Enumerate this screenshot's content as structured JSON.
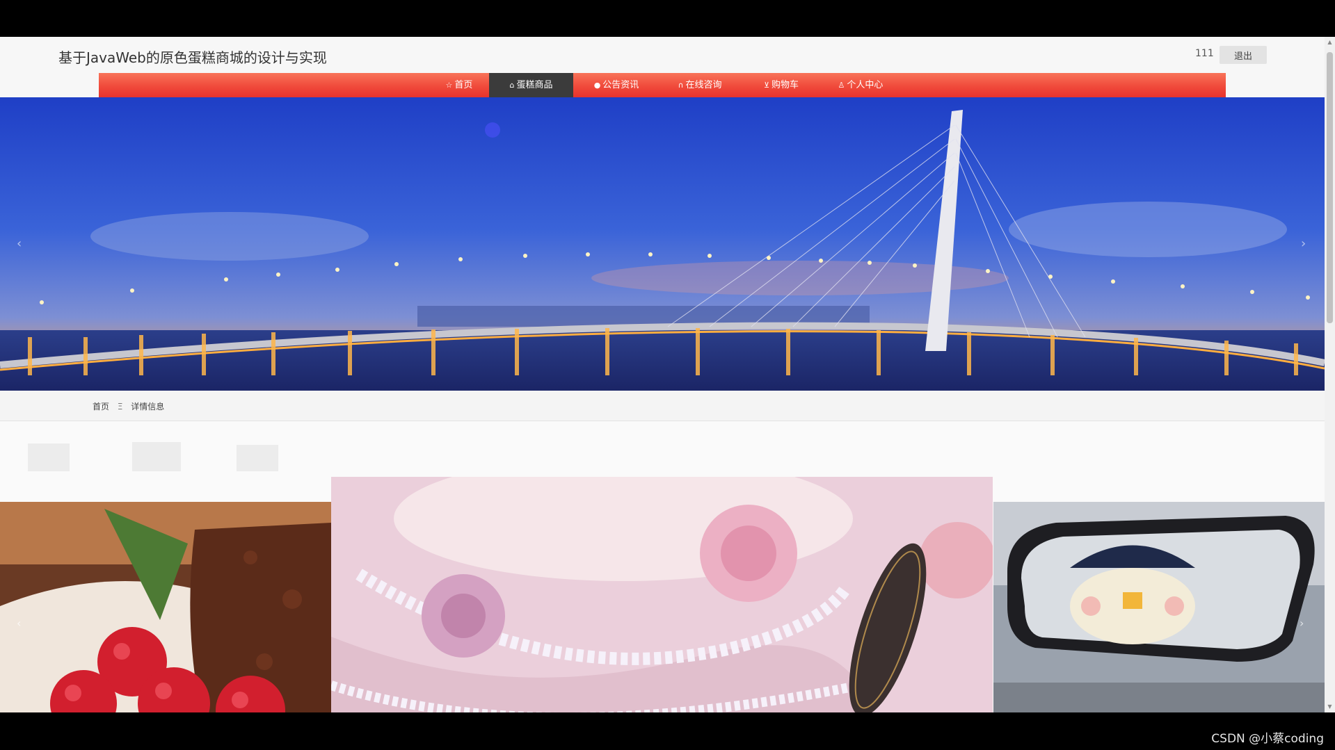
{
  "header": {
    "site_title": "基于JavaWeb的原色蛋糕商城的设计与实现",
    "user_name": "111",
    "logout_label": "退出"
  },
  "nav": {
    "items": [
      {
        "label": "首页",
        "icon": "star-icon"
      },
      {
        "label": "蛋糕商品",
        "icon": "lock-bag-icon",
        "active": true
      },
      {
        "label": "公告资讯",
        "icon": "info-icon"
      },
      {
        "label": "在线咨询",
        "icon": "headset-icon"
      },
      {
        "label": "购物车",
        "icon": "cart-icon"
      },
      {
        "label": "个人中心",
        "icon": "user-icon"
      }
    ],
    "active_color": "#3b3b3b",
    "bar_color": "#f04a3b"
  },
  "hero": {
    "image": "bridge-night-panorama"
  },
  "breadcrumb": {
    "home": "首页",
    "separator": "Ξ",
    "current": "详情信息"
  },
  "carousel": {
    "slides": [
      "raspberry-chocolate-cake",
      "pink-rose-cake",
      "car-mirror-plush"
    ],
    "active_index": 1,
    "slide_count": 3
  },
  "watermark": "CSDN @小蔡coding"
}
